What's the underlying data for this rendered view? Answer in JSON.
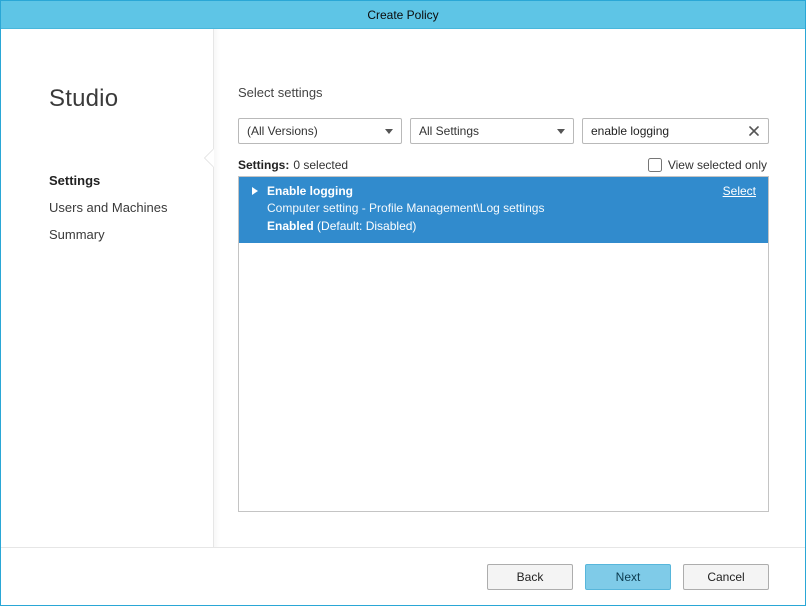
{
  "window": {
    "title": "Create Policy"
  },
  "sidebar": {
    "brand": "Studio",
    "items": [
      {
        "label": "Settings",
        "active": true
      },
      {
        "label": "Users and Machines",
        "active": false
      },
      {
        "label": "Summary",
        "active": false
      }
    ]
  },
  "main": {
    "heading": "Select settings",
    "version_combo": {
      "value": "(All Versions)"
    },
    "settings_combo": {
      "value": "All Settings"
    },
    "search": {
      "value": "enable logging"
    },
    "status": {
      "label": "Settings:",
      "count_text": "0 selected"
    },
    "view_selected_only": {
      "label": "View selected only",
      "checked": false
    },
    "results": [
      {
        "title": "Enable logging",
        "subtitle": "Computer setting - Profile Management\\Log settings",
        "state_value": "Enabled",
        "state_default": "(Default: Disabled)",
        "action_label": "Select"
      }
    ]
  },
  "footer": {
    "back": "Back",
    "next": "Next",
    "cancel": "Cancel"
  }
}
